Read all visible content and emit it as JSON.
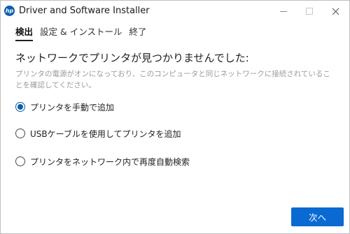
{
  "window": {
    "logo_text": "hp",
    "title": "Driver and Software Installer",
    "controls": [
      "minimize",
      "maximize",
      "close"
    ]
  },
  "steps": [
    {
      "label": "検出",
      "active": true
    },
    {
      "label": "設定 & インストール",
      "active": false
    },
    {
      "label": "終了",
      "active": false
    }
  ],
  "content": {
    "heading": "ネットワークでプリンタが見つかりませんでした:",
    "description": "プリンタの電源がオンになっており、このコンピュータと同じネットワークに接続されていることを確認してください。"
  },
  "options": [
    {
      "label": "プリンタを手動で追加",
      "selected": true
    },
    {
      "label": "USBケーブルを使用してプリンタを追加",
      "selected": false
    },
    {
      "label": "プリンタをネットワーク内で再度自動検索",
      "selected": false
    }
  ],
  "actions": {
    "next_label": "次へ"
  },
  "colors": {
    "accent": "#0a6ad2",
    "radio_selected": "#0b5cad",
    "hp_blue": "#0a5fae"
  }
}
